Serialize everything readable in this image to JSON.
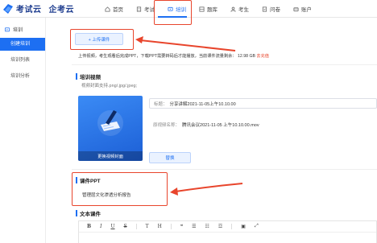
{
  "brand": {
    "logo_text": "考试云",
    "company_text": "企考云",
    "colors": {
      "primary": "#1d6ff2",
      "annotation": "#e8452c",
      "brand_dark": "#1e3d8f"
    }
  },
  "nav": {
    "items": [
      {
        "label": "首页",
        "icon": "home-icon"
      },
      {
        "label": "考试",
        "icon": "exam-icon"
      },
      {
        "label": "培训",
        "icon": "training-icon",
        "active": true
      },
      {
        "label": "题库",
        "icon": "question-bank-icon"
      },
      {
        "label": "考生",
        "icon": "examinee-icon"
      },
      {
        "label": "问卷",
        "icon": "survey-icon"
      },
      {
        "label": "账户",
        "icon": "account-icon"
      }
    ]
  },
  "sidebar": {
    "header": "培训",
    "items": [
      {
        "label": "创建培训",
        "active": true
      },
      {
        "label": "培训列表"
      },
      {
        "label": "培训分析"
      }
    ]
  },
  "upload": {
    "button_label": "+ 上传课件",
    "notice": "上传视频，考生观看后完成PPT，下载PPT需要转码后才能播放，当前课件流量剩余：",
    "quota": "12.98 GB",
    "recharge": "去充值"
  },
  "video": {
    "section_title": "培训视频",
    "hint": "视频封面支持.png/.jpg/.jpeg;",
    "cover_label": "更换视频封面",
    "title_label": "标题：",
    "title_value": "分享讲解2021-11-05上午10.10.00",
    "file_label": "原视频名称：",
    "file_value": "腾讯会议2021-11-05 上午10.10.00.mov",
    "replace_button": "替换"
  },
  "ppt": {
    "section_title": "课件PPT",
    "file_name": "管理层文化渗透分析报告"
  },
  "text_courseware": {
    "section_title": "文本课件",
    "toolbar": [
      "B",
      "I",
      "U",
      "S",
      "T",
      "H",
      "❝",
      "☰",
      "☷",
      "☲",
      "▣",
      "⤢"
    ]
  }
}
